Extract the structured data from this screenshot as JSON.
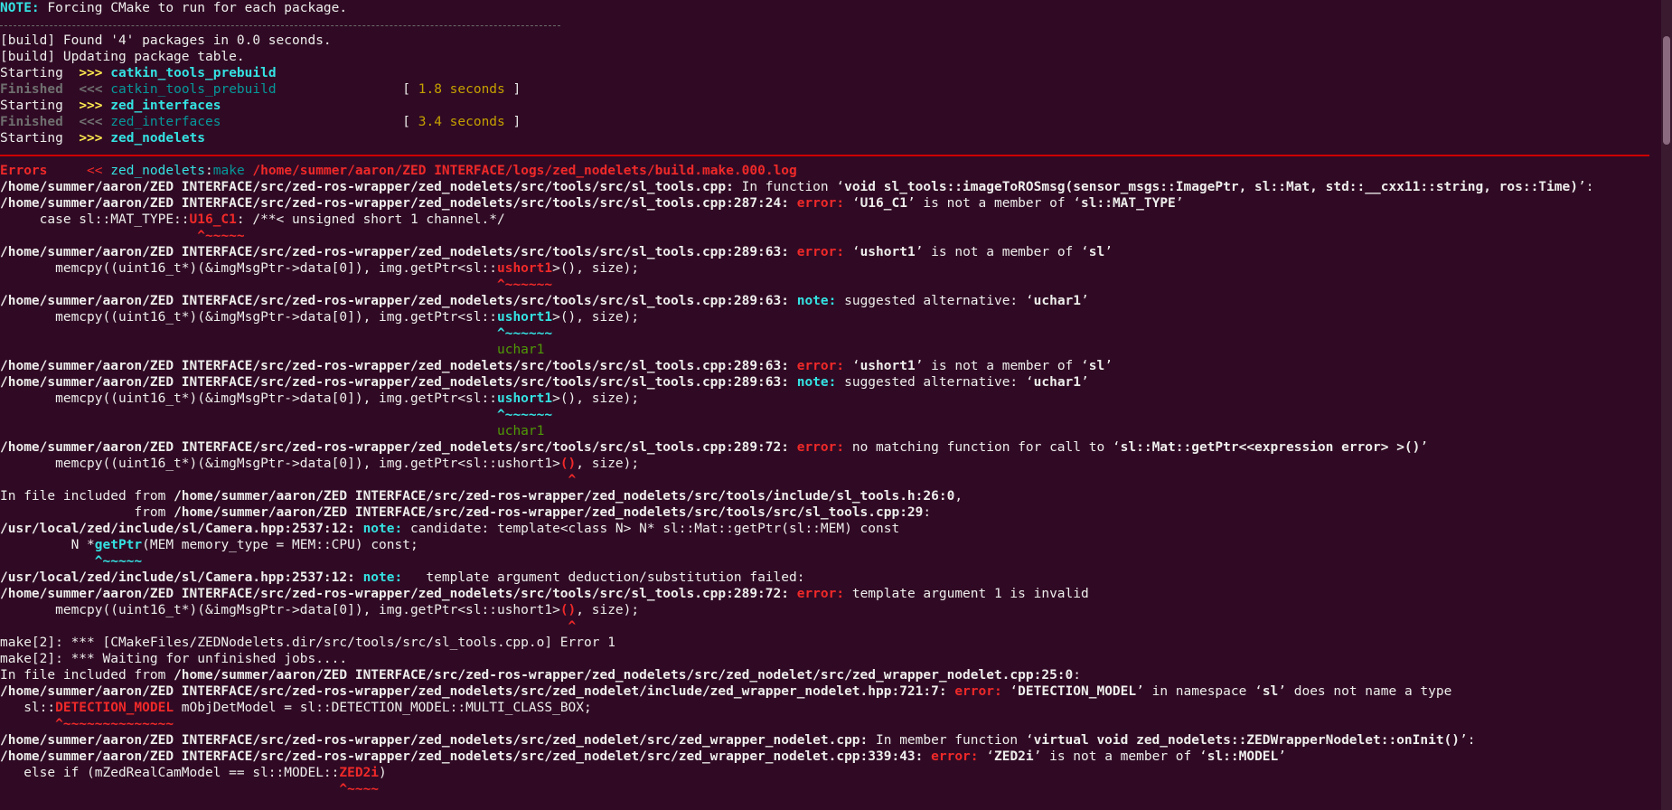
{
  "lines": [
    {
      "segs": [
        {
          "t": "NOTE:",
          "c": "cy"
        },
        {
          "t": " Forcing CMake to run for each package.",
          "c": ""
        }
      ]
    },
    {
      "sep": "grey"
    },
    {
      "segs": [
        {
          "t": "[build] Found '4' packages in 0.0 seconds.",
          "c": ""
        }
      ]
    },
    {
      "segs": [
        {
          "t": "[build] Updating package table.",
          "c": ""
        }
      ]
    },
    {
      "segs": [
        {
          "t": "Starting  ",
          "c": ""
        },
        {
          "t": ">>>",
          "c": "yl"
        },
        {
          "t": " ",
          "c": ""
        },
        {
          "t": "catkin_tools_prebuild",
          "c": "cy"
        }
      ]
    },
    {
      "segs": [
        {
          "t": "Finished",
          "c": "dim"
        },
        {
          "t": "  ",
          "c": ""
        },
        {
          "t": "<<<",
          "c": "dim"
        },
        {
          "t": " ",
          "c": ""
        },
        {
          "t": "catkin_tools_prebuild",
          "c": "dc"
        },
        {
          "t": "                ",
          "c": ""
        },
        {
          "t": "[ ",
          "c": ""
        },
        {
          "t": "1.8 seconds",
          "c": "gold"
        },
        {
          "t": " ]",
          "c": ""
        }
      ]
    },
    {
      "segs": [
        {
          "t": "Starting  ",
          "c": ""
        },
        {
          "t": ">>>",
          "c": "yl"
        },
        {
          "t": " ",
          "c": ""
        },
        {
          "t": "zed_interfaces",
          "c": "cy"
        }
      ]
    },
    {
      "segs": [
        {
          "t": "Finished",
          "c": "dim"
        },
        {
          "t": "  ",
          "c": ""
        },
        {
          "t": "<<<",
          "c": "dim"
        },
        {
          "t": " ",
          "c": ""
        },
        {
          "t": "zed_interfaces",
          "c": "dc"
        },
        {
          "t": "                       ",
          "c": ""
        },
        {
          "t": "[ ",
          "c": ""
        },
        {
          "t": "3.4 seconds",
          "c": "gold"
        },
        {
          "t": " ]",
          "c": ""
        }
      ]
    },
    {
      "segs": [
        {
          "t": "Starting  ",
          "c": ""
        },
        {
          "t": ">>>",
          "c": "yl"
        },
        {
          "t": " ",
          "c": ""
        },
        {
          "t": "zed_nodelets",
          "c": "cy"
        }
      ]
    },
    {
      "sep": "red"
    },
    {
      "segs": [
        {
          "t": "Errors",
          "c": "red"
        },
        {
          "t": "     ",
          "c": ""
        },
        {
          "t": "<<",
          "c": "redn"
        },
        {
          "t": " ",
          "c": ""
        },
        {
          "t": "zed_nodelets",
          "c": "cyn"
        },
        {
          "t": ":",
          "c": ""
        },
        {
          "t": "make",
          "c": "dc"
        },
        {
          "t": " ",
          "c": ""
        },
        {
          "t": "/home/summer/aaron/ZED INTERFACE/logs/zed_nodelets/build.make.000.log",
          "c": "red"
        }
      ]
    },
    {
      "segs": [
        {
          "t": "/home/summer/aaron/ZED INTERFACE/src/zed-ros-wrapper/zed_nodelets/src/tools/src/sl_tools.cpp:",
          "c": "b"
        },
        {
          "t": " In function ‘",
          "c": ""
        },
        {
          "t": "void sl_tools::imageToROSmsg(sensor_msgs::ImagePtr, sl::Mat, std::__cxx11::string, ros::Time)",
          "c": "b"
        },
        {
          "t": "’:",
          "c": ""
        }
      ]
    },
    {
      "segs": [
        {
          "t": "/home/summer/aaron/ZED INTERFACE/src/zed-ros-wrapper/zed_nodelets/src/tools/src/sl_tools.cpp:287:24:",
          "c": "b"
        },
        {
          "t": " ",
          "c": ""
        },
        {
          "t": "error:",
          "c": "red"
        },
        {
          "t": " ‘",
          "c": ""
        },
        {
          "t": "U16_C1",
          "c": "b"
        },
        {
          "t": "’ is not a member of ‘",
          "c": ""
        },
        {
          "t": "sl::MAT_TYPE",
          "c": "b"
        },
        {
          "t": "’",
          "c": ""
        }
      ]
    },
    {
      "segs": [
        {
          "t": "     case sl::MAT_TYPE::",
          "c": ""
        },
        {
          "t": "U16_C1",
          "c": "red"
        },
        {
          "t": ": /**< unsigned short 1 channel.*/",
          "c": ""
        }
      ]
    },
    {
      "segs": [
        {
          "t": "                         ",
          "c": ""
        },
        {
          "t": "^~~~~~",
          "c": "red"
        }
      ]
    },
    {
      "segs": [
        {
          "t": "/home/summer/aaron/ZED INTERFACE/src/zed-ros-wrapper/zed_nodelets/src/tools/src/sl_tools.cpp:289:63:",
          "c": "b"
        },
        {
          "t": " ",
          "c": ""
        },
        {
          "t": "error:",
          "c": "red"
        },
        {
          "t": " ‘",
          "c": ""
        },
        {
          "t": "ushort1",
          "c": "b"
        },
        {
          "t": "’ is not a member of ‘",
          "c": ""
        },
        {
          "t": "sl",
          "c": "b"
        },
        {
          "t": "’",
          "c": ""
        }
      ]
    },
    {
      "segs": [
        {
          "t": "       memcpy((uint16_t*)(&imgMsgPtr->data[0]), img.getPtr<sl::",
          "c": ""
        },
        {
          "t": "ushort1",
          "c": "red"
        },
        {
          "t": ">(), size);",
          "c": ""
        }
      ]
    },
    {
      "segs": [
        {
          "t": "                                                               ",
          "c": ""
        },
        {
          "t": "^~~~~~~",
          "c": "red"
        }
      ]
    },
    {
      "segs": [
        {
          "t": "/home/summer/aaron/ZED INTERFACE/src/zed-ros-wrapper/zed_nodelets/src/tools/src/sl_tools.cpp:289:63:",
          "c": "b"
        },
        {
          "t": " ",
          "c": ""
        },
        {
          "t": "note:",
          "c": "cy"
        },
        {
          "t": " suggested alternative: ‘",
          "c": ""
        },
        {
          "t": "uchar1",
          "c": "b"
        },
        {
          "t": "’",
          "c": ""
        }
      ]
    },
    {
      "segs": [
        {
          "t": "       memcpy((uint16_t*)(&imgMsgPtr->data[0]), img.getPtr<sl::",
          "c": ""
        },
        {
          "t": "ushort1",
          "c": "cy"
        },
        {
          "t": ">(), size);",
          "c": ""
        }
      ]
    },
    {
      "segs": [
        {
          "t": "                                                               ",
          "c": ""
        },
        {
          "t": "^~~~~~~",
          "c": "cy"
        }
      ]
    },
    {
      "segs": [
        {
          "t": "                                                               ",
          "c": ""
        },
        {
          "t": "uchar1",
          "c": "grn"
        }
      ]
    },
    {
      "segs": [
        {
          "t": "/home/summer/aaron/ZED INTERFACE/src/zed-ros-wrapper/zed_nodelets/src/tools/src/sl_tools.cpp:289:63:",
          "c": "b"
        },
        {
          "t": " ",
          "c": ""
        },
        {
          "t": "error:",
          "c": "red"
        },
        {
          "t": " ‘",
          "c": ""
        },
        {
          "t": "ushort1",
          "c": "b"
        },
        {
          "t": "’ is not a member of ‘",
          "c": ""
        },
        {
          "t": "sl",
          "c": "b"
        },
        {
          "t": "’",
          "c": ""
        }
      ]
    },
    {
      "segs": [
        {
          "t": "/home/summer/aaron/ZED INTERFACE/src/zed-ros-wrapper/zed_nodelets/src/tools/src/sl_tools.cpp:289:63:",
          "c": "b"
        },
        {
          "t": " ",
          "c": ""
        },
        {
          "t": "note:",
          "c": "cy"
        },
        {
          "t": " suggested alternative: ‘",
          "c": ""
        },
        {
          "t": "uchar1",
          "c": "b"
        },
        {
          "t": "’",
          "c": ""
        }
      ]
    },
    {
      "segs": [
        {
          "t": "       memcpy((uint16_t*)(&imgMsgPtr->data[0]), img.getPtr<sl::",
          "c": ""
        },
        {
          "t": "ushort1",
          "c": "cy"
        },
        {
          "t": ">(), size);",
          "c": ""
        }
      ]
    },
    {
      "segs": [
        {
          "t": "                                                               ",
          "c": ""
        },
        {
          "t": "^~~~~~~",
          "c": "cy"
        }
      ]
    },
    {
      "segs": [
        {
          "t": "                                                               ",
          "c": ""
        },
        {
          "t": "uchar1",
          "c": "grn"
        }
      ]
    },
    {
      "segs": [
        {
          "t": "/home/summer/aaron/ZED INTERFACE/src/zed-ros-wrapper/zed_nodelets/src/tools/src/sl_tools.cpp:289:72:",
          "c": "b"
        },
        {
          "t": " ",
          "c": ""
        },
        {
          "t": "error:",
          "c": "red"
        },
        {
          "t": " no matching function for call to ‘",
          "c": ""
        },
        {
          "t": "sl::Mat::getPtr<<expression error> >()",
          "c": "b"
        },
        {
          "t": "’",
          "c": ""
        }
      ]
    },
    {
      "segs": [
        {
          "t": "       memcpy((uint16_t*)(&imgMsgPtr->data[0]), img.getPtr<sl::ushort1>",
          "c": ""
        },
        {
          "t": "()",
          "c": "red"
        },
        {
          "t": ", size);",
          "c": ""
        }
      ]
    },
    {
      "segs": [
        {
          "t": "                                                                        ",
          "c": ""
        },
        {
          "t": "^",
          "c": "red"
        }
      ]
    },
    {
      "segs": [
        {
          "t": "In file included from ",
          "c": ""
        },
        {
          "t": "/home/summer/aaron/ZED INTERFACE/src/zed-ros-wrapper/zed_nodelets/src/tools/include/sl_tools.h:26:0",
          "c": "b"
        },
        {
          "t": ",",
          "c": ""
        }
      ]
    },
    {
      "segs": [
        {
          "t": "                 from ",
          "c": ""
        },
        {
          "t": "/home/summer/aaron/ZED INTERFACE/src/zed-ros-wrapper/zed_nodelets/src/tools/src/sl_tools.cpp:29",
          "c": "b"
        },
        {
          "t": ":",
          "c": ""
        }
      ]
    },
    {
      "segs": [
        {
          "t": "/usr/local/zed/include/sl/Camera.hpp:2537:12:",
          "c": "b"
        },
        {
          "t": " ",
          "c": ""
        },
        {
          "t": "note:",
          "c": "cy"
        },
        {
          "t": " candidate: template<class N> N* sl::Mat::getPtr(sl::MEM) const",
          "c": ""
        }
      ]
    },
    {
      "segs": [
        {
          "t": "         N *",
          "c": ""
        },
        {
          "t": "getPtr",
          "c": "cy"
        },
        {
          "t": "(MEM memory_type = MEM::CPU) const;",
          "c": ""
        }
      ]
    },
    {
      "segs": [
        {
          "t": "            ",
          "c": ""
        },
        {
          "t": "^~~~~~",
          "c": "cy"
        }
      ]
    },
    {
      "segs": [
        {
          "t": "/usr/local/zed/include/sl/Camera.hpp:2537:12:",
          "c": "b"
        },
        {
          "t": " ",
          "c": ""
        },
        {
          "t": "note:",
          "c": "cy"
        },
        {
          "t": "   template argument deduction/substitution failed:",
          "c": ""
        }
      ]
    },
    {
      "segs": [
        {
          "t": "/home/summer/aaron/ZED INTERFACE/src/zed-ros-wrapper/zed_nodelets/src/tools/src/sl_tools.cpp:289:72:",
          "c": "b"
        },
        {
          "t": " ",
          "c": ""
        },
        {
          "t": "error:",
          "c": "red"
        },
        {
          "t": " template argument 1 is invalid",
          "c": ""
        }
      ]
    },
    {
      "segs": [
        {
          "t": "       memcpy((uint16_t*)(&imgMsgPtr->data[0]), img.getPtr<sl::ushort1>",
          "c": ""
        },
        {
          "t": "()",
          "c": "red"
        },
        {
          "t": ", size);",
          "c": ""
        }
      ]
    },
    {
      "segs": [
        {
          "t": "                                                                        ",
          "c": ""
        },
        {
          "t": "^",
          "c": "red"
        }
      ]
    },
    {
      "segs": [
        {
          "t": "make[2]: *** [CMakeFiles/ZEDNodelets.dir/src/tools/src/sl_tools.cpp.o] Error 1",
          "c": ""
        }
      ]
    },
    {
      "segs": [
        {
          "t": "make[2]: *** Waiting for unfinished jobs....",
          "c": ""
        }
      ]
    },
    {
      "segs": [
        {
          "t": "In file included from ",
          "c": ""
        },
        {
          "t": "/home/summer/aaron/ZED INTERFACE/src/zed-ros-wrapper/zed_nodelets/src/zed_nodelet/src/zed_wrapper_nodelet.cpp:25:0",
          "c": "b"
        },
        {
          "t": ":",
          "c": ""
        }
      ]
    },
    {
      "segs": [
        {
          "t": "/home/summer/aaron/ZED INTERFACE/src/zed-ros-wrapper/zed_nodelets/src/zed_nodelet/include/zed_wrapper_nodelet.hpp:721:7:",
          "c": "b"
        },
        {
          "t": " ",
          "c": ""
        },
        {
          "t": "error:",
          "c": "red"
        },
        {
          "t": " ‘",
          "c": ""
        },
        {
          "t": "DETECTION_MODEL",
          "c": "b"
        },
        {
          "t": "’ in namespace ‘",
          "c": ""
        },
        {
          "t": "sl",
          "c": "b"
        },
        {
          "t": "’ does not name a type",
          "c": ""
        }
      ]
    },
    {
      "segs": [
        {
          "t": "   sl::",
          "c": ""
        },
        {
          "t": "DETECTION_MODEL",
          "c": "red"
        },
        {
          "t": " mObjDetModel = sl::DETECTION_MODEL::MULTI_CLASS_BOX;",
          "c": ""
        }
      ]
    },
    {
      "segs": [
        {
          "t": "       ",
          "c": ""
        },
        {
          "t": "^~~~~~~~~~~~~~~",
          "c": "red"
        }
      ]
    },
    {
      "segs": [
        {
          "t": "/home/summer/aaron/ZED INTERFACE/src/zed-ros-wrapper/zed_nodelets/src/zed_nodelet/src/zed_wrapper_nodelet.cpp:",
          "c": "b"
        },
        {
          "t": " In member function ‘",
          "c": ""
        },
        {
          "t": "virtual void zed_nodelets::ZEDWrapperNodelet::onInit()",
          "c": "b"
        },
        {
          "t": "’:",
          "c": ""
        }
      ]
    },
    {
      "segs": [
        {
          "t": "/home/summer/aaron/ZED INTERFACE/src/zed-ros-wrapper/zed_nodelets/src/zed_nodelet/src/zed_wrapper_nodelet.cpp:339:43:",
          "c": "b"
        },
        {
          "t": " ",
          "c": ""
        },
        {
          "t": "error:",
          "c": "red"
        },
        {
          "t": " ‘",
          "c": ""
        },
        {
          "t": "ZED2i",
          "c": "b"
        },
        {
          "t": "’ is not a member of ‘",
          "c": ""
        },
        {
          "t": "sl::MODEL",
          "c": "b"
        },
        {
          "t": "’",
          "c": ""
        }
      ]
    },
    {
      "segs": [
        {
          "t": "   else if (mZedRealCamModel == sl::MODEL::",
          "c": ""
        },
        {
          "t": "ZED2i",
          "c": "red"
        },
        {
          "t": ")",
          "c": ""
        }
      ]
    },
    {
      "segs": [
        {
          "t": "                                           ",
          "c": ""
        },
        {
          "t": "^~~~~",
          "c": "red"
        }
      ]
    }
  ]
}
